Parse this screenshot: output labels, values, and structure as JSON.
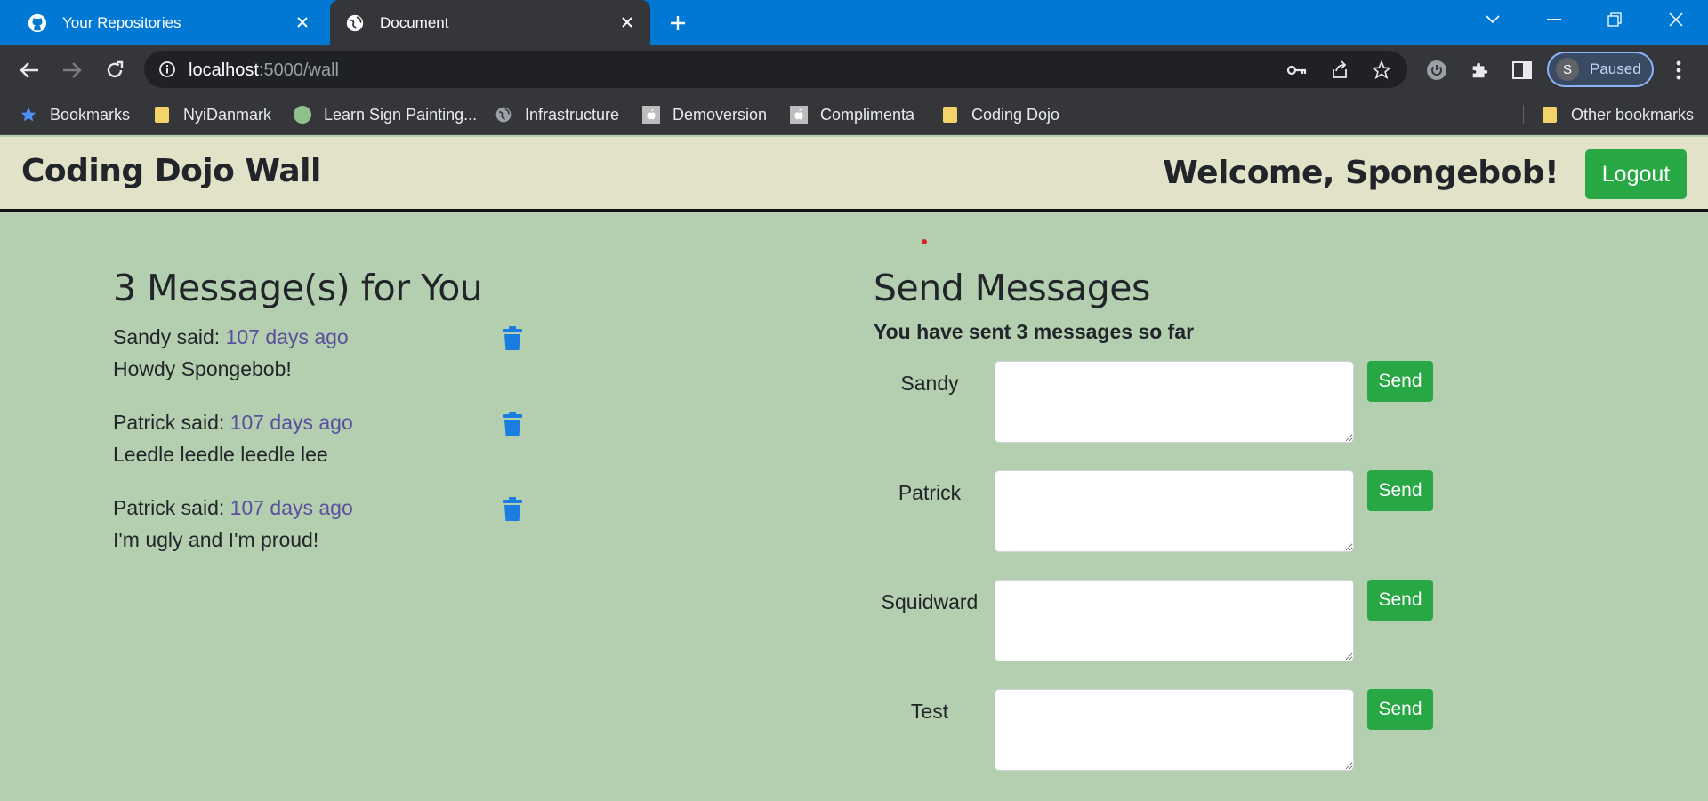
{
  "browser": {
    "tabs": [
      {
        "title": "Your Repositories",
        "icon": "github-icon"
      },
      {
        "title": "Document",
        "icon": "globe-icon"
      }
    ],
    "url_host": "localhost",
    "url_path": ":5000/wall",
    "profile_initial": "S",
    "profile_status": "Paused",
    "bookmarks": [
      {
        "label": "Bookmarks",
        "icon": "star-icon"
      },
      {
        "label": "NyiDanmark",
        "icon": "folder-icon"
      },
      {
        "label": "Learn Sign Painting...",
        "icon": "circle-icon"
      },
      {
        "label": "Infrastructure",
        "icon": "globe-icon"
      },
      {
        "label": "Demoversion",
        "icon": "apple-icon"
      },
      {
        "label": "Complimenta",
        "icon": "apple-icon"
      },
      {
        "label": "Coding Dojo",
        "icon": "folder-icon"
      },
      {
        "label": "Other bookmarks",
        "icon": "folder-icon"
      }
    ]
  },
  "header": {
    "brand": "Coding Dojo Wall",
    "welcome": "Welcome, Spongebob!",
    "logout_label": "Logout"
  },
  "inbox": {
    "title": "3 Message(s) for You",
    "messages": [
      {
        "sender": "Sandy said: ",
        "time": "107 days ago",
        "text": "Howdy Spongebob!"
      },
      {
        "sender": "Patrick said: ",
        "time": "107 days ago",
        "text": "Leedle leedle leedle lee"
      },
      {
        "sender": "Patrick said: ",
        "time": "107 days ago",
        "text": "I'm ugly and I'm proud!"
      }
    ]
  },
  "send": {
    "title": "Send Messages",
    "sent_count_text": "You have sent 3 messages so far",
    "recipients": [
      {
        "name": "Sandy",
        "value": "",
        "button": "Send"
      },
      {
        "name": "Patrick",
        "value": "",
        "button": "Send"
      },
      {
        "name": "Squidward",
        "value": "",
        "button": "Send"
      },
      {
        "name": "Test",
        "value": "",
        "button": "Send"
      }
    ]
  },
  "colors": {
    "page_bg": "#b3cfb0",
    "header_bg": "#e2e2c8",
    "accent_green": "#28a745",
    "trash_blue": "#1a7de0",
    "link_purple": "#5b4f9d",
    "chrome_blue": "#0078d4"
  }
}
